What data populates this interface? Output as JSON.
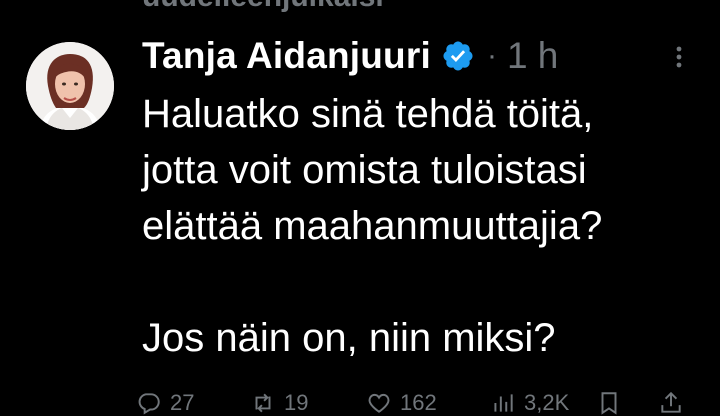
{
  "previous_tweet": {
    "text_fragment": "uudelleenjulkaisi"
  },
  "tweet": {
    "author_name": "Tanja Aidanjuuri",
    "separator": "·",
    "time": "1 h",
    "text": "Haluatko sinä tehdä töitä,\njotta voit omista tuloistasi\nelättää maahanmuuttajia?\n\nJos näin on, niin miksi?",
    "verified": true
  },
  "actions": {
    "replies": "27",
    "reposts": "19",
    "likes": "162",
    "views": "3,2K"
  },
  "colors": {
    "background": "#000000",
    "text": "#ffffff",
    "muted": "#71767b",
    "verified_badge": "#1d9bf0"
  },
  "icons": {
    "verified": "verified-badge-icon",
    "more": "more-options-icon",
    "reply": "reply-icon",
    "repost": "repost-icon",
    "like": "heart-icon",
    "views": "views-chart-icon",
    "bookmark": "bookmark-icon",
    "share": "share-icon"
  }
}
